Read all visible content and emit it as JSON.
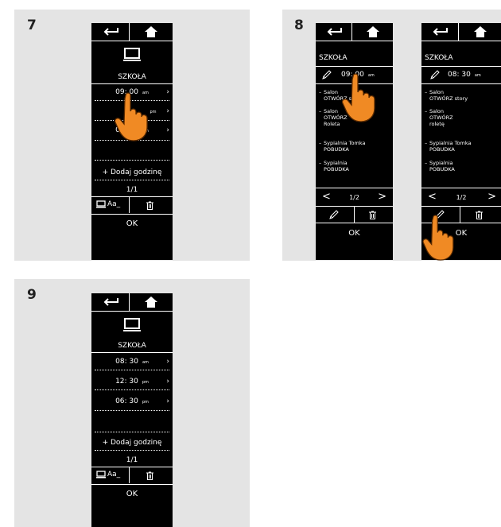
{
  "colors": {
    "panel": "#e4e4e4",
    "screen": "#000000",
    "hand": "#f08a24",
    "hand_outline": "#5a2a00"
  },
  "icons": [
    "back-arrow-icon",
    "home-icon",
    "monitor-icon",
    "pencil-icon",
    "trash-icon",
    "keyboard-icon",
    "pointing-hand-icon"
  ],
  "steps": {
    "step7": {
      "number": "7",
      "title": "SZKOŁA",
      "schedules": [
        {
          "time": "09: 00",
          "ampm": "am"
        },
        {
          "time": "",
          "ampm": "pm"
        },
        {
          "time": "07: 30",
          "ampm": "pm"
        }
      ],
      "add": "+ Dodaj godzinę",
      "page": "1/1",
      "rename": "Aa_",
      "ok": "OK"
    },
    "step8": {
      "number": "8",
      "left": {
        "title": "SZKOŁA",
        "time": "09: 00",
        "ampm": "am",
        "items": [
          {
            "line1": "Salon",
            "line2": "OTWÓRZ story"
          },
          {
            "line1": "Salon",
            "line2": "OTWÓRZ",
            "line3": "Roleta"
          },
          {
            "line1": "Sypialnia Tomka",
            "line2": "POBUDKA"
          },
          {
            "line1": "Sypialnia",
            "line2": "POBUDKA"
          }
        ],
        "page": "1/2",
        "ok": "OK"
      },
      "right": {
        "title": "SZKOŁA",
        "time": "08: 30",
        "ampm": "am",
        "items": [
          {
            "line1": "Salon",
            "line2": "OTWÓRZ story"
          },
          {
            "line1": "Salon",
            "line2": "OTWÓRZ",
            "line3": "roletę"
          },
          {
            "line1": "Sypialnia Tomka",
            "line2": "POBUDKA"
          },
          {
            "line1": "Sypialnia",
            "line2": "POBUDKA"
          }
        ],
        "page": "1/2",
        "ok": "OK"
      }
    },
    "step9": {
      "number": "9",
      "title": "SZKOŁA",
      "schedules": [
        {
          "time": "08: 30",
          "ampm": "am"
        },
        {
          "time": "12: 30",
          "ampm": "pm"
        },
        {
          "time": "06: 30",
          "ampm": "pm"
        }
      ],
      "add": "+ Dodaj godzinę",
      "page": "1/1",
      "rename": "Aa_",
      "ok": "OK"
    }
  }
}
